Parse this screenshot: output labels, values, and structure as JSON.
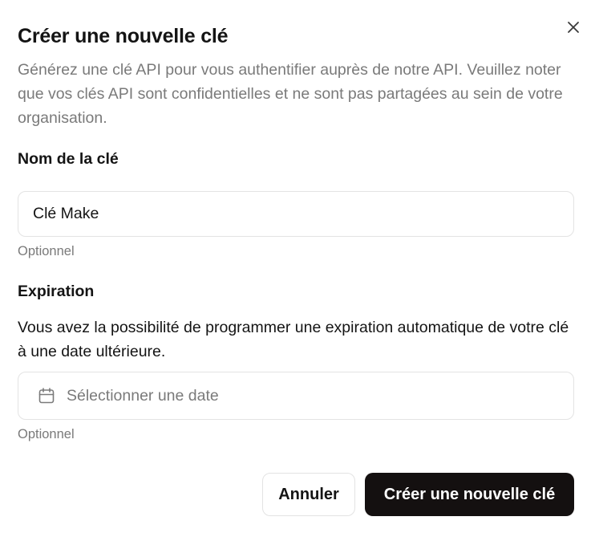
{
  "dialog": {
    "title": "Créer une nouvelle clé",
    "description": "Générez une clé API pour vous authentifier auprès de notre API. Veuillez noter que vos clés API sont confidentielles et ne sont pas partagées au sein de votre organisation.",
    "close_icon": "close-icon"
  },
  "name_field": {
    "label": "Nom de la clé",
    "value": "Clé Make",
    "hint": "Optionnel"
  },
  "expiration_field": {
    "label": "Expiration",
    "description": "Vous avez la possibilité de programmer une expiration automatique de votre clé à une date ultérieure.",
    "placeholder": "Sélectionner une date",
    "icon": "calendar-icon",
    "hint": "Optionnel"
  },
  "actions": {
    "cancel_label": "Annuler",
    "submit_label": "Créer une nouvelle clé"
  },
  "colors": {
    "primary_button": "#141010",
    "muted_text": "#7a7a7a",
    "border": "#e3e3e3"
  }
}
